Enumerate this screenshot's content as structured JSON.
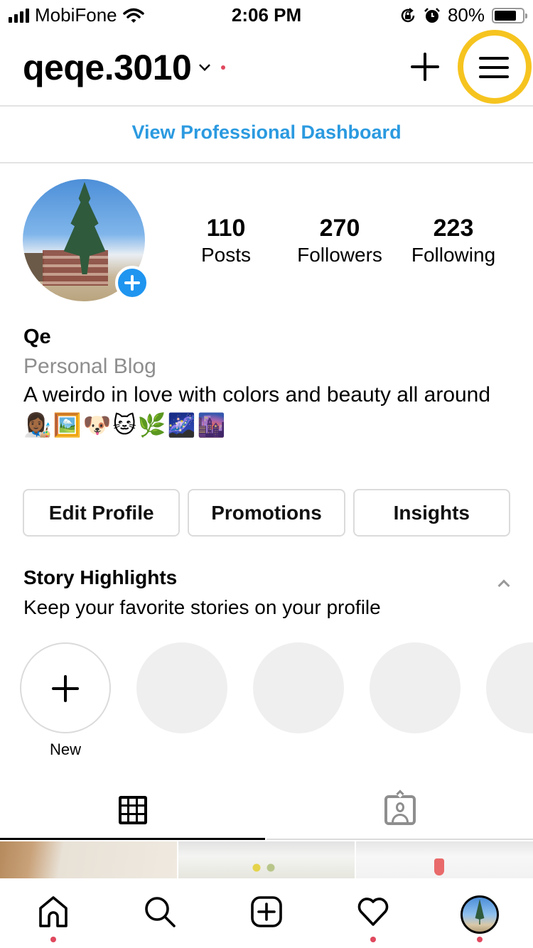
{
  "status_bar": {
    "carrier": "MobiFone",
    "time": "2:06 PM",
    "battery_percent_label": "80%",
    "battery_level": 0.8,
    "icons": [
      "signal-icon",
      "wifi-icon",
      "rotation-lock-icon",
      "alarm-icon",
      "battery-icon"
    ]
  },
  "header": {
    "username": "qeqe.3010",
    "dropdown_icon": "chevron-down-icon",
    "notification_dot": true,
    "create_icon": "plus-icon",
    "menu_icon": "hamburger-menu-icon",
    "highlight_color": "#f6c41f"
  },
  "dashboard": {
    "label": "View Professional Dashboard",
    "color": "#2b9ae0"
  },
  "profile": {
    "add_story_icon": "plus-badge-icon",
    "stats": [
      {
        "value": "110",
        "label": "Posts"
      },
      {
        "value": "270",
        "label": "Followers"
      },
      {
        "value": "223",
        "label": "Following"
      }
    ],
    "name": "Qe",
    "category": "Personal Blog",
    "bio": "A weirdo in love with colors and beauty all around",
    "bio_emoji": "👩🏾‍🎨🖼️🐶🐱🌿🌌🌆"
  },
  "actions": {
    "edit_profile": "Edit Profile",
    "promotions": "Promotions",
    "insights": "Insights"
  },
  "highlights": {
    "title": "Story Highlights",
    "subtitle": "Keep your favorite stories on your profile",
    "collapse_icon": "chevron-up-icon",
    "new_label": "New"
  },
  "tabs": [
    {
      "name": "grid",
      "icon": "grid-icon",
      "active": true
    },
    {
      "name": "tagged",
      "icon": "tagged-photos-icon",
      "active": false
    }
  ],
  "bottom_nav": [
    {
      "name": "home",
      "icon": "home-icon",
      "dot": true
    },
    {
      "name": "search",
      "icon": "search-icon",
      "dot": false
    },
    {
      "name": "create",
      "icon": "add-post-icon",
      "dot": false
    },
    {
      "name": "activity",
      "icon": "heart-icon",
      "dot": true
    },
    {
      "name": "profile",
      "icon": "profile-avatar-icon",
      "dot": true
    }
  ],
  "colors": {
    "accent_blue": "#1f95f0",
    "notification_red": "#e0485e",
    "secondary_text": "#8e8e8e",
    "border": "#dbdbdb"
  }
}
